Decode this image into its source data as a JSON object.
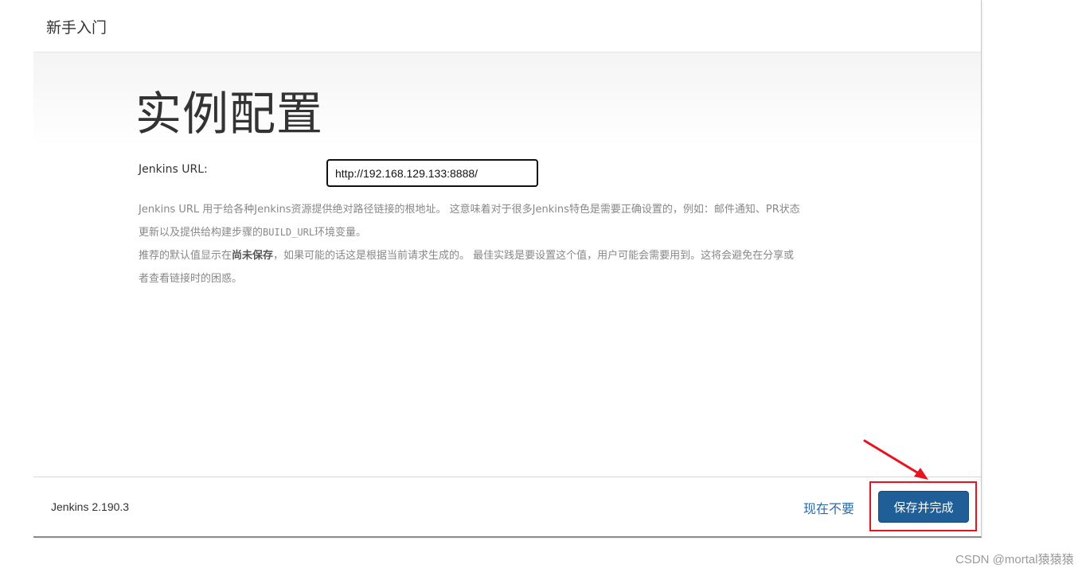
{
  "header": {
    "title": "新手入门"
  },
  "main": {
    "heading": "实例配置",
    "url_label": "Jenkins URL:",
    "url_value": "http://192.168.129.133:8888/",
    "help": {
      "line1": "Jenkins URL 用于给各种Jenkins资源提供绝对路径链接的根地址。 这意味着对于很多Jenkins特色是需要正确设置的，例如：邮件通知、PR状态",
      "line2_a": "更新以及提供给构建步骤的",
      "line2_code": "BUILD_URL",
      "line2_b": "环境变量。",
      "line3_a": "推荐的默认值显示在",
      "line3_bold": "尚未保存",
      "line3_b": "，如果可能的话这是根据当前请求生成的。 最佳实践是要设置这个值，用户可能会需要用到。这将会避免在分享或",
      "line4": "者查看链接时的困惑。"
    }
  },
  "footer": {
    "version": "Jenkins 2.190.3",
    "skip_label": "现在不要",
    "save_label": "保存并完成"
  },
  "annotation": {
    "color": "#e8131e"
  },
  "watermark": "CSDN @mortal猿猿猿",
  "colors": {
    "primary_button": "#1f5e96",
    "link": "#2c6aa8",
    "help_text": "#888888"
  }
}
